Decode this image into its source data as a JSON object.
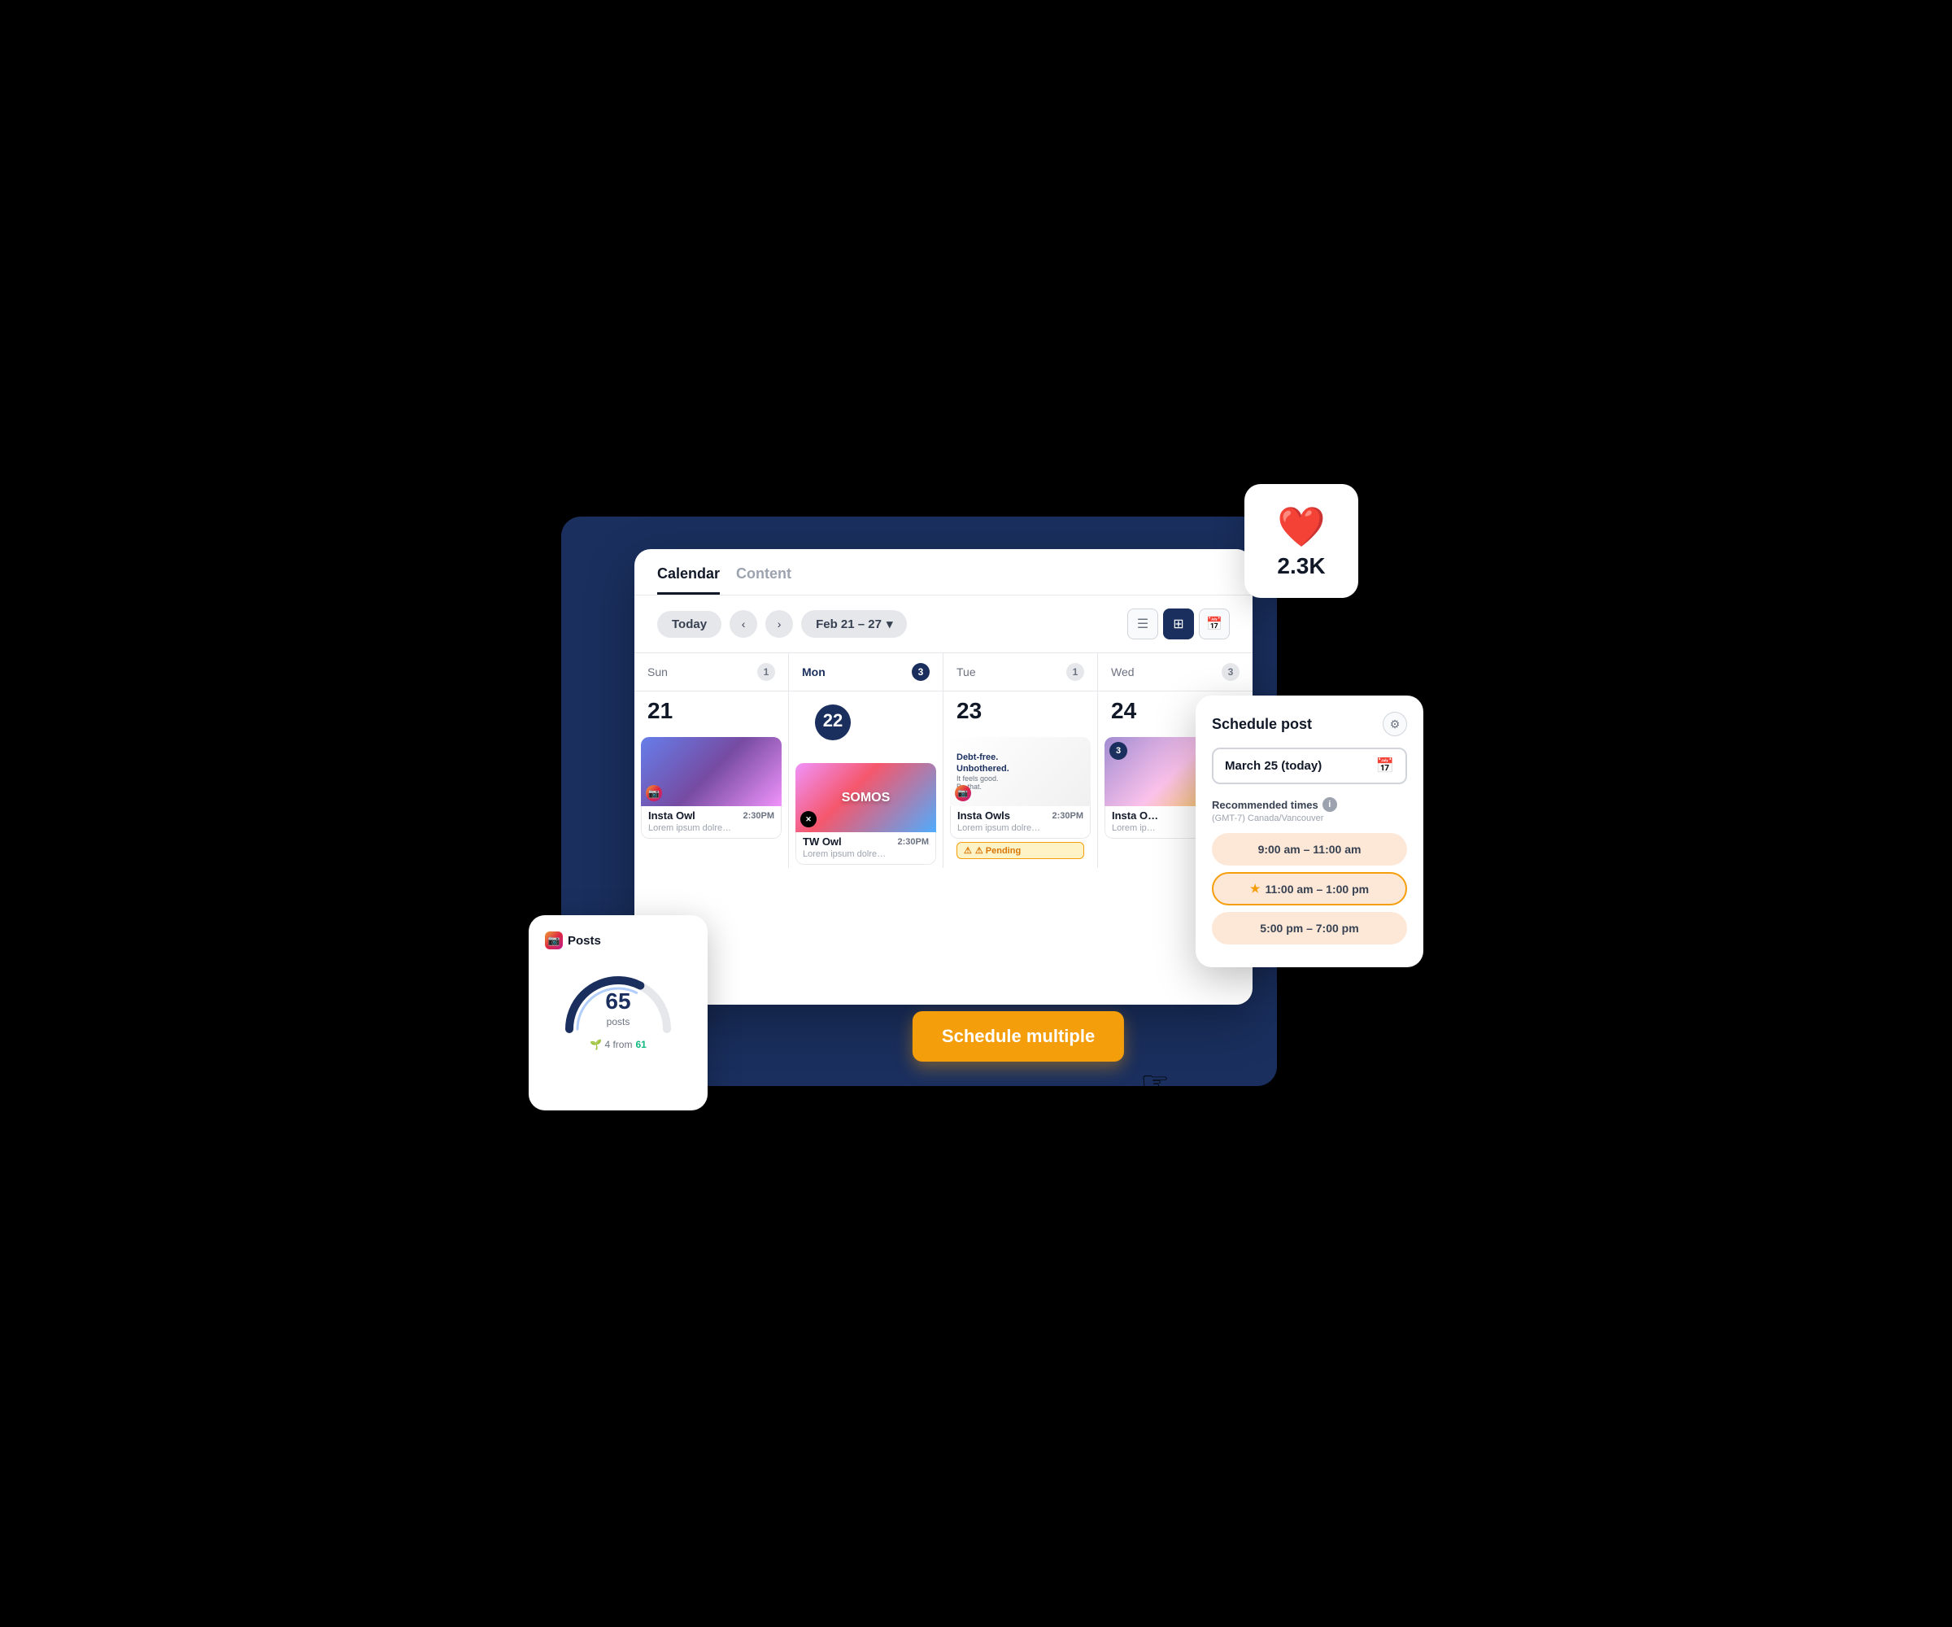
{
  "tabs": {
    "calendar": "Calendar",
    "content": "Content",
    "active": "Calendar"
  },
  "toolbar": {
    "today_label": "Today",
    "prev_icon": "‹",
    "next_icon": "›",
    "date_range": "Feb 21 – 27",
    "date_range_arrow": "▾",
    "view_list_icon": "≡",
    "view_grid_icon": "⊞",
    "view_cal_icon": "📅"
  },
  "days": [
    {
      "name": "Sun",
      "number": "21",
      "badge": "1",
      "active": false
    },
    {
      "name": "Mon",
      "number": "22",
      "badge": "3",
      "active": true
    },
    {
      "name": "Tue",
      "number": "23",
      "badge": "1",
      "active": false
    },
    {
      "name": "Wed",
      "number": "24",
      "badge": "3",
      "active": false
    }
  ],
  "posts": {
    "sun_post": {
      "title": "Insta Owl",
      "time": "2:30PM",
      "desc": "Lorem ipsum dolre..."
    },
    "mon_post": {
      "title": "TW Owl",
      "time": "2:30PM",
      "desc": "Lorem ipsum dolre..."
    },
    "tue_post": {
      "title": "Insta Owls",
      "time": "2:30PM",
      "desc": "Lorem ipsum dolre...",
      "pending": "⚠ Pending"
    },
    "wed_post": {
      "title": "Insta O...",
      "time": "",
      "desc": "Lorem ip..."
    }
  },
  "likes_card": {
    "count": "2.3K"
  },
  "posts_card": {
    "title": "Posts",
    "count": "65",
    "label": "posts",
    "footer_prefix": "🌱 4 from",
    "footer_link": "61"
  },
  "schedule_btn": {
    "label": "Schedule multiple"
  },
  "schedule_panel": {
    "title": "Schedule post",
    "gear_icon": "⚙",
    "date_value": "March 25 (today)",
    "cal_icon": "📅",
    "recommended_title": "Recommended times",
    "recommended_sub": "(GMT-7) Canada/Vancouver",
    "time_slots": [
      {
        "label": "9:00 am – 11:00 am",
        "selected": false,
        "star": false
      },
      {
        "label": "11:00 am – 1:00 pm",
        "selected": true,
        "star": true
      },
      {
        "label": "5:00 pm – 7:00 pm",
        "selected": false,
        "star": false
      }
    ]
  },
  "colors": {
    "navy": "#1a2f5e",
    "accent_orange": "#f59e0b",
    "accent_red": "#ef4444",
    "pending_bg": "#fef3c7",
    "pending_border": "#f59e0b"
  }
}
